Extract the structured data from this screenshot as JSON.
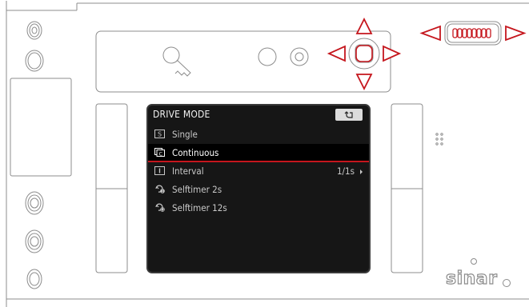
{
  "menu": {
    "title": "DRIVE MODE",
    "items": [
      {
        "label": "Single",
        "value": "",
        "icon": "single-shot-icon"
      },
      {
        "label": "Continuous",
        "value": "",
        "icon": "continuous-shot-icon",
        "selected": true
      },
      {
        "label": "Interval",
        "value": "1/1s",
        "icon": "interval-icon"
      },
      {
        "label": "Selftimer 2s",
        "value": "",
        "icon": "selftimer-icon"
      },
      {
        "label": "Selftimer 12s",
        "value": "",
        "icon": "selftimer-icon"
      }
    ]
  },
  "brand": {
    "name": "sinar"
  },
  "colors": {
    "accent": "#c5161d",
    "screen_bg": "#161616",
    "outline": "#8c8c8c"
  }
}
